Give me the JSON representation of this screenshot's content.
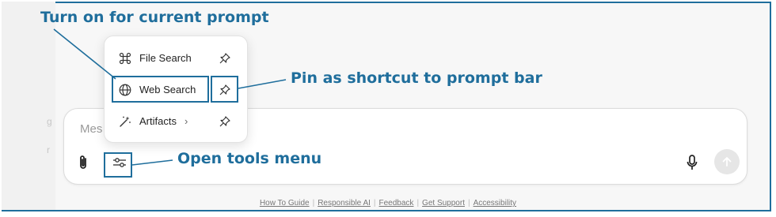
{
  "callouts": {
    "turn_on": "Turn on for current prompt",
    "pin": "Pin as shortcut to prompt bar",
    "open_tools": "Open tools menu"
  },
  "composer": {
    "placeholder": "Mes"
  },
  "tools_menu": {
    "items": [
      {
        "label": "File Search",
        "icon": "command-icon",
        "pin_icon": "pin-icon"
      },
      {
        "label": "Web Search",
        "icon": "globe-icon",
        "pin_icon": "pin-icon"
      },
      {
        "label": "Artifacts",
        "icon": "magic-wand-icon",
        "submenu": "›",
        "pin_icon": "pin-icon"
      }
    ]
  },
  "footer": {
    "links": [
      "How To Guide",
      "Responsible AI",
      "Feedback",
      "Get Support",
      "Accessibility"
    ],
    "separator": "|"
  },
  "colors": {
    "annotation": "#1f6e9c",
    "send_disabled": "#e6e6e6"
  }
}
